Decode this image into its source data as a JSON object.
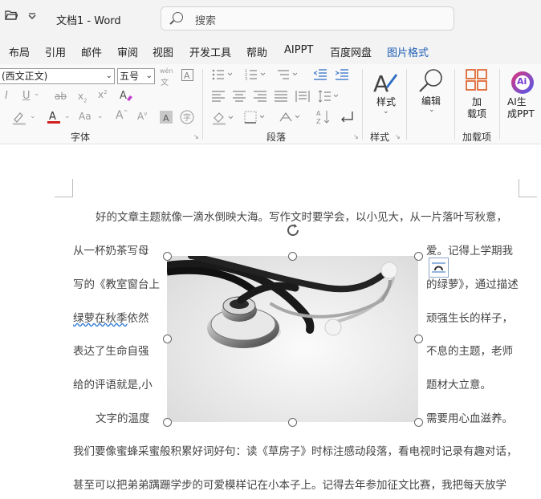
{
  "title_bar": {
    "doc_title": "文档1  -  Word",
    "search_placeholder": "搜索"
  },
  "tabs": [
    "布局",
    "引用",
    "邮件",
    "审阅",
    "视图",
    "开发工具",
    "帮助",
    "AIPPT",
    "百度网盘",
    "图片格式"
  ],
  "active_tab": "图片格式",
  "ribbon": {
    "font_name": "(西文正文)",
    "font_size": "五号",
    "phonetic": "wén",
    "groups": {
      "font": "字体",
      "paragraph": "段落",
      "styles": "样式",
      "addins": "加载项"
    },
    "big_buttons": {
      "styles": "样式",
      "editing": "编辑",
      "addins_line1": "加",
      "addins_line2": "载项",
      "ai_line1": "AI生",
      "ai_line2": "成PPT",
      "ai_logo": "Ai"
    }
  },
  "document": {
    "line1": "好的文章主题就像一滴水倒映大海。写作文时要学会，以小见大，从一片落叶写秋意，",
    "line2_left": "从一杯奶茶写母",
    "line2_right": "爱。记得上学期我",
    "line3_left": "写的《教室窗台上",
    "line3_right": "的绿萝》，通过描述",
    "line4_left_underlined": "绿萝在秋季",
    "line4_left_rest": "依然",
    "line4_right": "顽强生长的样子，",
    "line5_left": "表达了生命自强",
    "line5_right": "不息的主题，老师",
    "line6_left": "给的评语就是,小",
    "line6_right": "题材大立意。",
    "line7_left": "文字的温度",
    "line7_right": "需要用心血滋养。",
    "line8": "我们要像蜜蜂采蜜般积累好词好句：读《草房子》时标注感动段落，看电视时记录有趣对话，",
    "line9": "甚至可以把弟弟蹒跚学步的可爱模样记在小本子上。记得去年参加征文比赛，我把每天放学"
  },
  "colors": {
    "active_tab": "#1f5fb4",
    "font_color_bar": "#d11f1f",
    "highlight_bar": "#cccccc",
    "spell_underline": "#2e7bd6",
    "ai_logo_gradient_start": "#e0357a",
    "ai_logo_gradient_end": "#4a5cf0",
    "addins_icon": "#d9581d"
  },
  "icons": [
    "folder-open-icon",
    "customize-chevron-icon",
    "search-icon",
    "rotate-handle-icon",
    "layout-options-icon",
    "stethoscope-image"
  ]
}
